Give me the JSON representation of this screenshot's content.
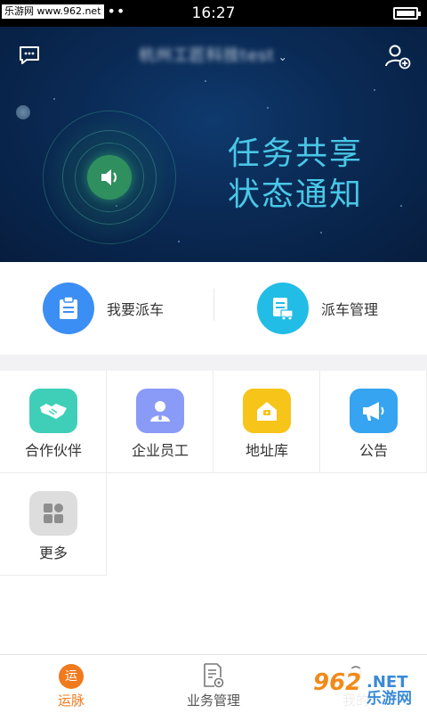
{
  "status_bar": {
    "watermark": "乐游网 www.962.net",
    "dots": "•••",
    "time": "16:27"
  },
  "header": {
    "company_name": "杭州工匠科技test",
    "message_icon": "message-icon",
    "add_user_icon": "add-user-icon"
  },
  "banner": {
    "slogan_line1": "任务共享",
    "slogan_line2": "状态通知",
    "icon": "speaker-icon"
  },
  "dispatch": {
    "items": [
      {
        "label": "我要派车",
        "icon": "clipboard-icon",
        "color": "#3b8ef3"
      },
      {
        "label": "派车管理",
        "icon": "truck-list-icon",
        "color": "#22bde6"
      }
    ]
  },
  "grid": {
    "items": [
      {
        "label": "合作伙伴",
        "icon": "handshake-icon",
        "color": "#3fcfb9"
      },
      {
        "label": "企业员工",
        "icon": "employee-icon",
        "color": "#8a9bf7"
      },
      {
        "label": "地址库",
        "icon": "home-address-icon",
        "color": "#f7c41a"
      },
      {
        "label": "公告",
        "icon": "megaphone-icon",
        "color": "#36a4f0"
      },
      {
        "label": "更多",
        "icon": "more-grid-icon",
        "color": "#dddddd"
      }
    ]
  },
  "tabbar": {
    "tabs": [
      {
        "label": "运脉",
        "badge": "运",
        "active": true
      },
      {
        "label": "业务管理",
        "active": false
      },
      {
        "label": "我的",
        "active": false
      }
    ]
  },
  "watermark_br": {
    "brand_num": "962",
    "brand_net": ".NET",
    "brand_cn": "乐游网"
  }
}
